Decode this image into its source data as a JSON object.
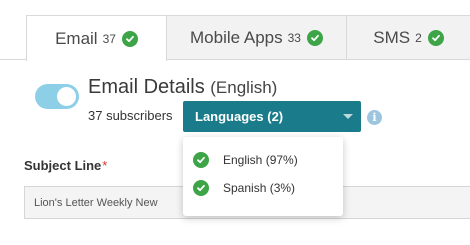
{
  "tabs": [
    {
      "label": "Email",
      "count": "37",
      "status_icon": "check-circle-icon"
    },
    {
      "label": "Mobile Apps",
      "count": "33",
      "status_icon": "check-circle-icon"
    },
    {
      "label": "SMS",
      "count": "2",
      "status_icon": "check-circle-icon"
    }
  ],
  "details": {
    "toggle_on": true,
    "title": "Email Details",
    "language": "(English)",
    "subscribers": "37 subscribers",
    "languages_select": "Languages (2)",
    "info_icon": "info-icon"
  },
  "languages_dropdown": [
    {
      "label": "English (97%)",
      "icon": "check-circle-icon"
    },
    {
      "label": "Spanish (3%)",
      "icon": "check-circle-icon"
    }
  ],
  "subject": {
    "label": "Subject Line",
    "required_mark": "*",
    "value": "Lion's Letter Weekly New"
  },
  "colors": {
    "accent": "#1a7c8a",
    "success": "#3da447",
    "toggle": "#8ecfe8",
    "required": "#d0352b"
  }
}
